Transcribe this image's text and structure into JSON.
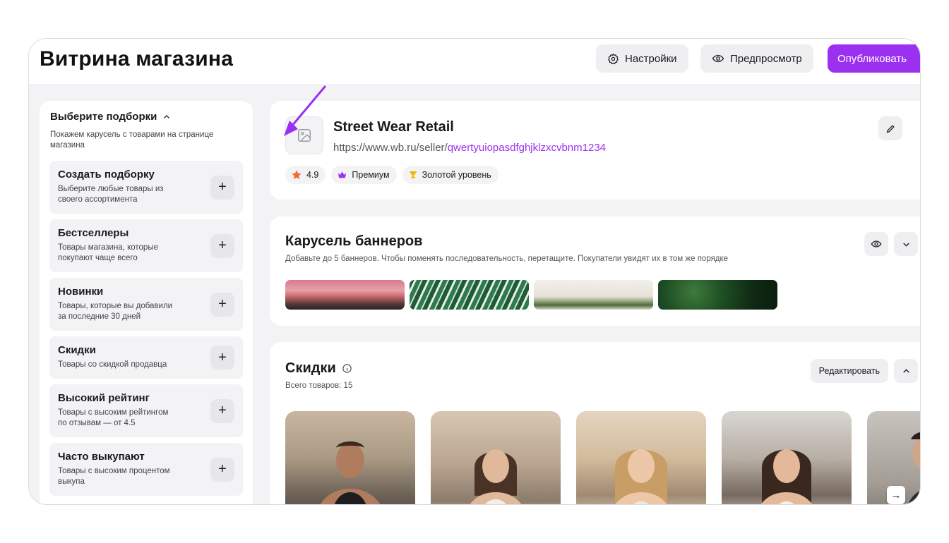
{
  "header": {
    "title": "Витрина магазина",
    "settings_label": "Настройки",
    "preview_label": "Предпросмотр",
    "publish_label": "Опубликовать",
    "accent_color": "#9b30f0"
  },
  "sidebar": {
    "heading": "Выберите подборки",
    "description": "Покажем карусель с товарами на странице магазина",
    "cards": [
      {
        "title": "Создать подборку",
        "desc": "Выберите любые товары из своего ассортимента"
      },
      {
        "title": "Бестселлеры",
        "desc": "Товары магазина, которые покупают чаще всего"
      },
      {
        "title": "Новинки",
        "desc": "Товары, которые вы добавили за последние 30 дней"
      },
      {
        "title": "Скидки",
        "desc": "Товары со скидкой продавца"
      },
      {
        "title": "Высокий рейтинг",
        "desc": "Товары с высоким рейтингом по отзывам — от 4.5"
      },
      {
        "title": "Часто выкупают",
        "desc": "Товары с высоким процентом выкупа"
      }
    ]
  },
  "shop": {
    "name": "Street Wear Retail",
    "url_prefix": "https://www.wb.ru/seller/",
    "url_slug": "qwertyuiopasdfghjklzxcvbnm1234",
    "rating": "4.9",
    "badge_premium": "Премиум",
    "badge_gold": "Золотой уровень"
  },
  "banners": {
    "title": "Карусель баннеров",
    "subtitle": "Добавьте до 5 баннеров. Чтобы поменять последовательность, перетащите. Покупатели увидят их в том же порядке"
  },
  "discounts": {
    "title": "Скидки",
    "count_label": "Всего товаров: 15",
    "edit_label": "Редактировать"
  }
}
